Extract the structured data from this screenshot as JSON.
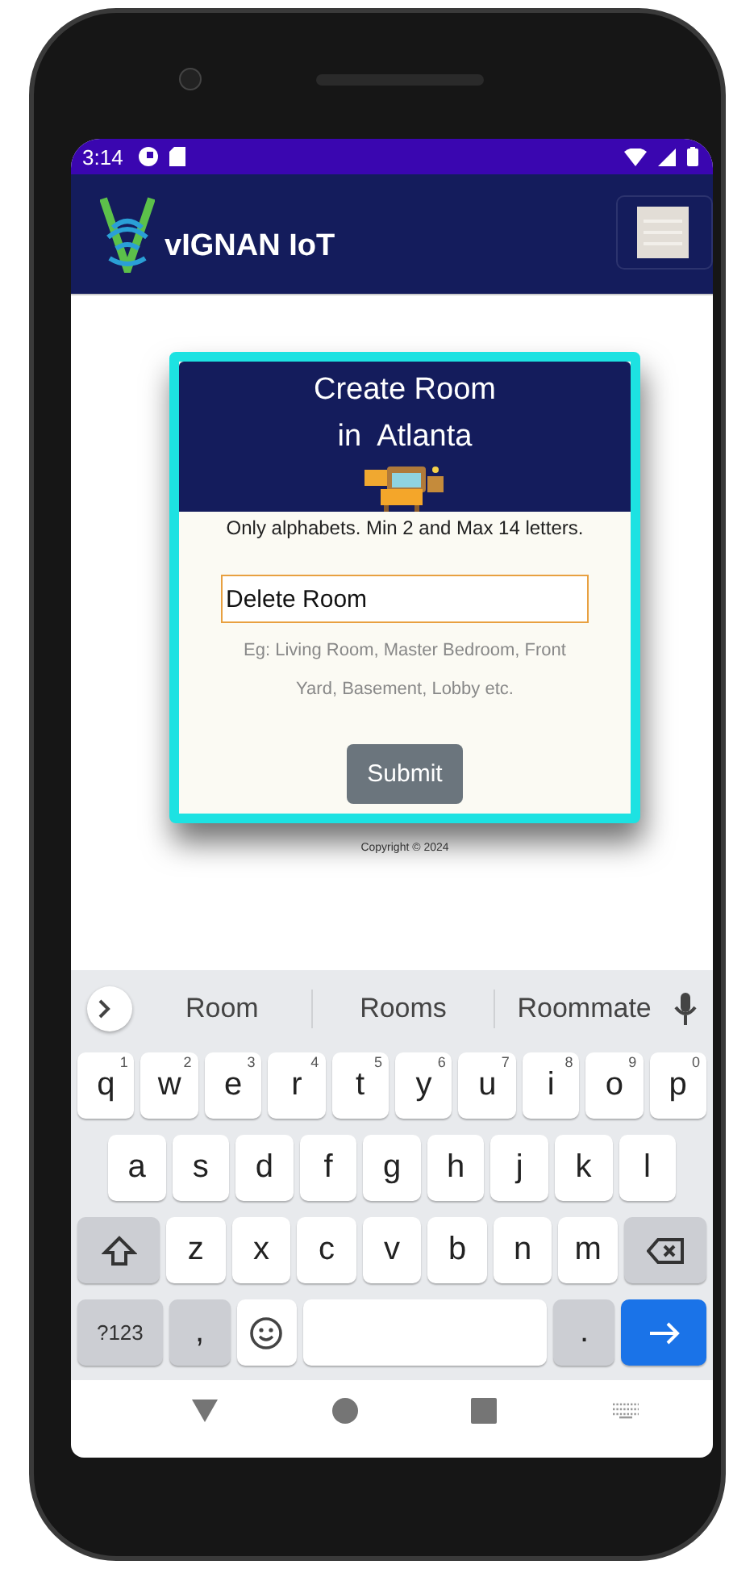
{
  "status_bar": {
    "time": "3:14"
  },
  "app_bar": {
    "title": "vIGNAN IoT"
  },
  "dialog": {
    "title_lines": [
      "Create Room",
      "in  Atlanta"
    ],
    "instruction": "Only alphabets. Min 2 and Max 14 letters.",
    "input": {
      "value": "Delete Room"
    },
    "hint": "Eg: Living Room, Master Bedroom, Front Yard, Basement, Lobby etc.",
    "submit": "Submit"
  },
  "footer": {
    "copyright": "Copyright © 2024"
  },
  "keyboard": {
    "suggestions": [
      "Room",
      "Rooms",
      "Roommate"
    ],
    "key_rows": [
      {
        "keys": [
          {
            "kind": "letter",
            "label": "q",
            "hint": "1"
          },
          {
            "kind": "letter",
            "label": "w",
            "hint": "2"
          },
          {
            "kind": "letter",
            "label": "e",
            "hint": "3"
          },
          {
            "kind": "letter",
            "label": "r",
            "hint": "4"
          },
          {
            "kind": "letter",
            "label": "t",
            "hint": "5"
          },
          {
            "kind": "letter",
            "label": "y",
            "hint": "6"
          },
          {
            "kind": "letter",
            "label": "u",
            "hint": "7"
          },
          {
            "kind": "letter",
            "label": "i",
            "hint": "8"
          },
          {
            "kind": "letter",
            "label": "o",
            "hint": "9"
          },
          {
            "kind": "letter",
            "label": "p",
            "hint": "0"
          }
        ]
      },
      {
        "keys": [
          {
            "kind": "letter",
            "label": "a"
          },
          {
            "kind": "letter",
            "label": "s"
          },
          {
            "kind": "letter",
            "label": "d"
          },
          {
            "kind": "letter",
            "label": "f"
          },
          {
            "kind": "letter",
            "label": "g"
          },
          {
            "kind": "letter",
            "label": "h"
          },
          {
            "kind": "letter",
            "label": "j"
          },
          {
            "kind": "letter",
            "label": "k"
          },
          {
            "kind": "letter",
            "label": "l"
          }
        ]
      },
      {
        "keys": [
          {
            "kind": "shift"
          },
          {
            "kind": "letter",
            "label": "z"
          },
          {
            "kind": "letter",
            "label": "x"
          },
          {
            "kind": "letter",
            "label": "c"
          },
          {
            "kind": "letter",
            "label": "v"
          },
          {
            "kind": "letter",
            "label": "b"
          },
          {
            "kind": "letter",
            "label": "n"
          },
          {
            "kind": "letter",
            "label": "m"
          },
          {
            "kind": "backspace"
          }
        ]
      },
      {
        "keys": [
          {
            "kind": "symbols",
            "label": "?123"
          },
          {
            "kind": "punct",
            "label": ","
          },
          {
            "kind": "emoji"
          },
          {
            "kind": "space"
          },
          {
            "kind": "punct",
            "label": "."
          },
          {
            "kind": "enter"
          }
        ]
      }
    ]
  }
}
